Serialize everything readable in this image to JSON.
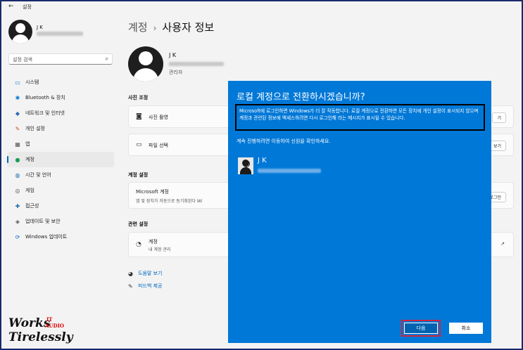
{
  "titlebar": {
    "back_glyph": "←",
    "title": "설정"
  },
  "sidebar": {
    "user_name": "J K",
    "search_placeholder": "설정 검색",
    "items": [
      {
        "icon": "system-icon",
        "glyph": "▭",
        "label": "시스템",
        "color": "#0078d4"
      },
      {
        "icon": "bluetooth-icon",
        "glyph": "✱",
        "label": "Bluetooth & 장치",
        "color": "#0078d4"
      },
      {
        "icon": "network-icon",
        "glyph": "◆",
        "label": "네트워크 및 인터넷",
        "color": "#2b6cb0"
      },
      {
        "icon": "brush-icon",
        "glyph": "✎",
        "label": "개인 설정",
        "color": "#c0562a"
      },
      {
        "icon": "apps-icon",
        "glyph": "▦",
        "label": "앱",
        "color": "#555"
      },
      {
        "icon": "accounts-icon",
        "glyph": "●",
        "label": "계정",
        "color": "#1b9a59",
        "active": true
      },
      {
        "icon": "time-language-icon",
        "glyph": "◍",
        "label": "시간 및 언어",
        "color": "#1a6fb5"
      },
      {
        "icon": "gaming-icon",
        "glyph": "◎",
        "label": "게임",
        "color": "#555"
      },
      {
        "icon": "accessibility-icon",
        "glyph": "✚",
        "label": "접근성",
        "color": "#1a6fb5"
      },
      {
        "icon": "shield-icon",
        "glyph": "◈",
        "label": "업데이트 및 보안",
        "color": "#555"
      },
      {
        "icon": "windows-update-icon",
        "glyph": "⟳",
        "label": "Windows 업데이트",
        "color": "#0067c0"
      }
    ]
  },
  "main": {
    "breadcrumb_parent": "계정",
    "breadcrumb_sep": "›",
    "breadcrumb_current": "사용자 정보",
    "account_name": "J K",
    "account_role": "관리자",
    "photo_section": "사진 조정",
    "photo_items": [
      {
        "label": "사진 촬영",
        "button": "기"
      },
      {
        "label": "파일 선택",
        "button": "보기"
      }
    ],
    "account_settings_section": "계정 설정",
    "ms_account_title": "Microsoft 계정",
    "ms_account_desc": "앱 및 장치가 자동으로 동기화된다 Wi",
    "ms_account_link": "로그인",
    "related_section": "관련 설정",
    "related_item_title": "계정",
    "related_item_desc": "내 계정 관리",
    "help_links": [
      "도움말 보기",
      "피드백 제공"
    ]
  },
  "dialog": {
    "title": "로컬 계정으로 전환하시겠습니까?",
    "box_text": "Microsoft에 로그인하면 Windows가 더 잘 작동합니다. 로컬 계정으로 전환하면 모든 장치에 개인 설정이 표시되지 않으며 계정과 관련된 정보에 액세스하려면 다시 로그인해 라는 메시지가 표시될 수 있습니다.",
    "prompt": "계속 진행하려면 이동하여 신원을 확인하세요.",
    "user_name": "J K",
    "next_label": "다음",
    "cancel_label": "취소"
  },
  "watermark": {
    "line1": "Works",
    "line2": "Tirelessly",
    "tag1": "IT",
    "tag2": "AUDIO"
  },
  "colors": {
    "accent": "#0078d7",
    "highlight": "#d0243a"
  }
}
